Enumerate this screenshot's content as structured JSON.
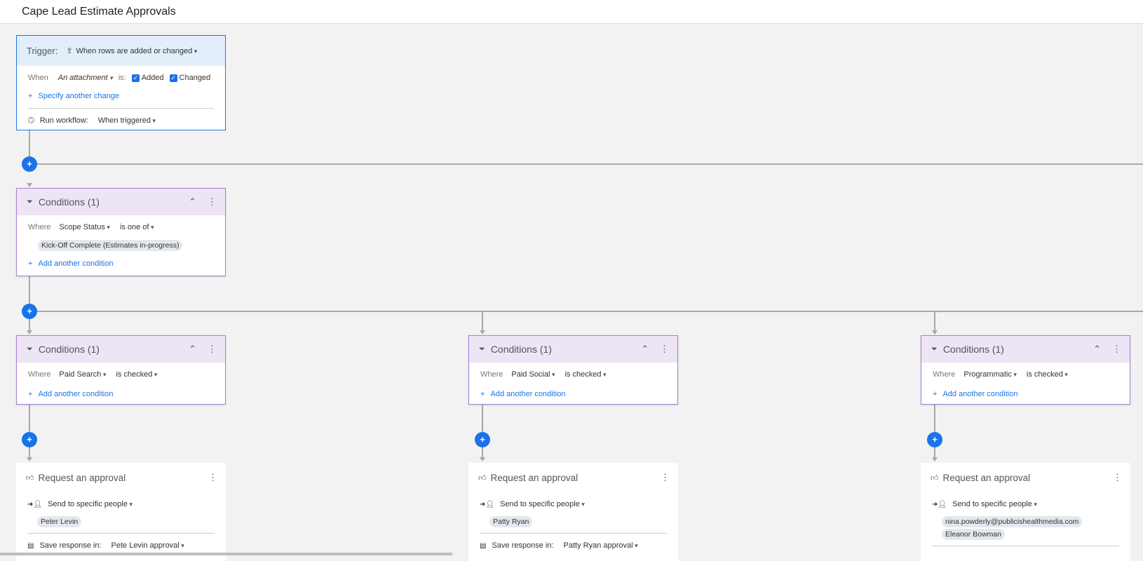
{
  "header": {
    "title": "Cape Lead Estimate Approvals"
  },
  "trigger": {
    "label": "Trigger:",
    "event": "When rows are added or changed",
    "when_label": "When",
    "field": "An attachment",
    "is_label": "is:",
    "added": "Added",
    "changed": "Changed",
    "specify": "Specify another change",
    "run_label": "Run workflow:",
    "run_value": "When triggered"
  },
  "condition_main": {
    "title": "Conditions (1)",
    "where": "Where",
    "field": "Scope Status",
    "operator": "is one of",
    "value": "Kick-Off Complete (Estimates in-progress)",
    "add": "Add another condition"
  },
  "branches": [
    {
      "condition": {
        "title": "Conditions (1)",
        "where": "Where",
        "field": "Paid Search",
        "operator": "is checked",
        "add": "Add another condition"
      },
      "approval": {
        "title": "Request an approval",
        "send": "Send to specific people",
        "people": [
          "Peter Levin"
        ],
        "save_label": "Save response in:",
        "save_value": "Pete Levin approval"
      }
    },
    {
      "condition": {
        "title": "Conditions (1)",
        "where": "Where",
        "field": "Paid Social",
        "operator": "is checked",
        "add": "Add another condition"
      },
      "approval": {
        "title": "Request an approval",
        "send": "Send to specific people",
        "people": [
          "Patty Ryan"
        ],
        "save_label": "Save response in:",
        "save_value": "Patty Ryan approval"
      }
    },
    {
      "condition": {
        "title": "Conditions (1)",
        "where": "Where",
        "field": "Programmatic",
        "operator": "is checked",
        "add": "Add another condition"
      },
      "approval": {
        "title": "Request an approval",
        "send": "Send to specific people",
        "people": [
          "nina.powderly@publicishealthmedia.com",
          "Eleanor Bowman"
        ]
      }
    }
  ],
  "colors": {
    "accent": "#1a73e8",
    "condition_header": "#ede4f5",
    "condition_border": "#a77fd4",
    "trigger_header": "#e3eefb"
  }
}
